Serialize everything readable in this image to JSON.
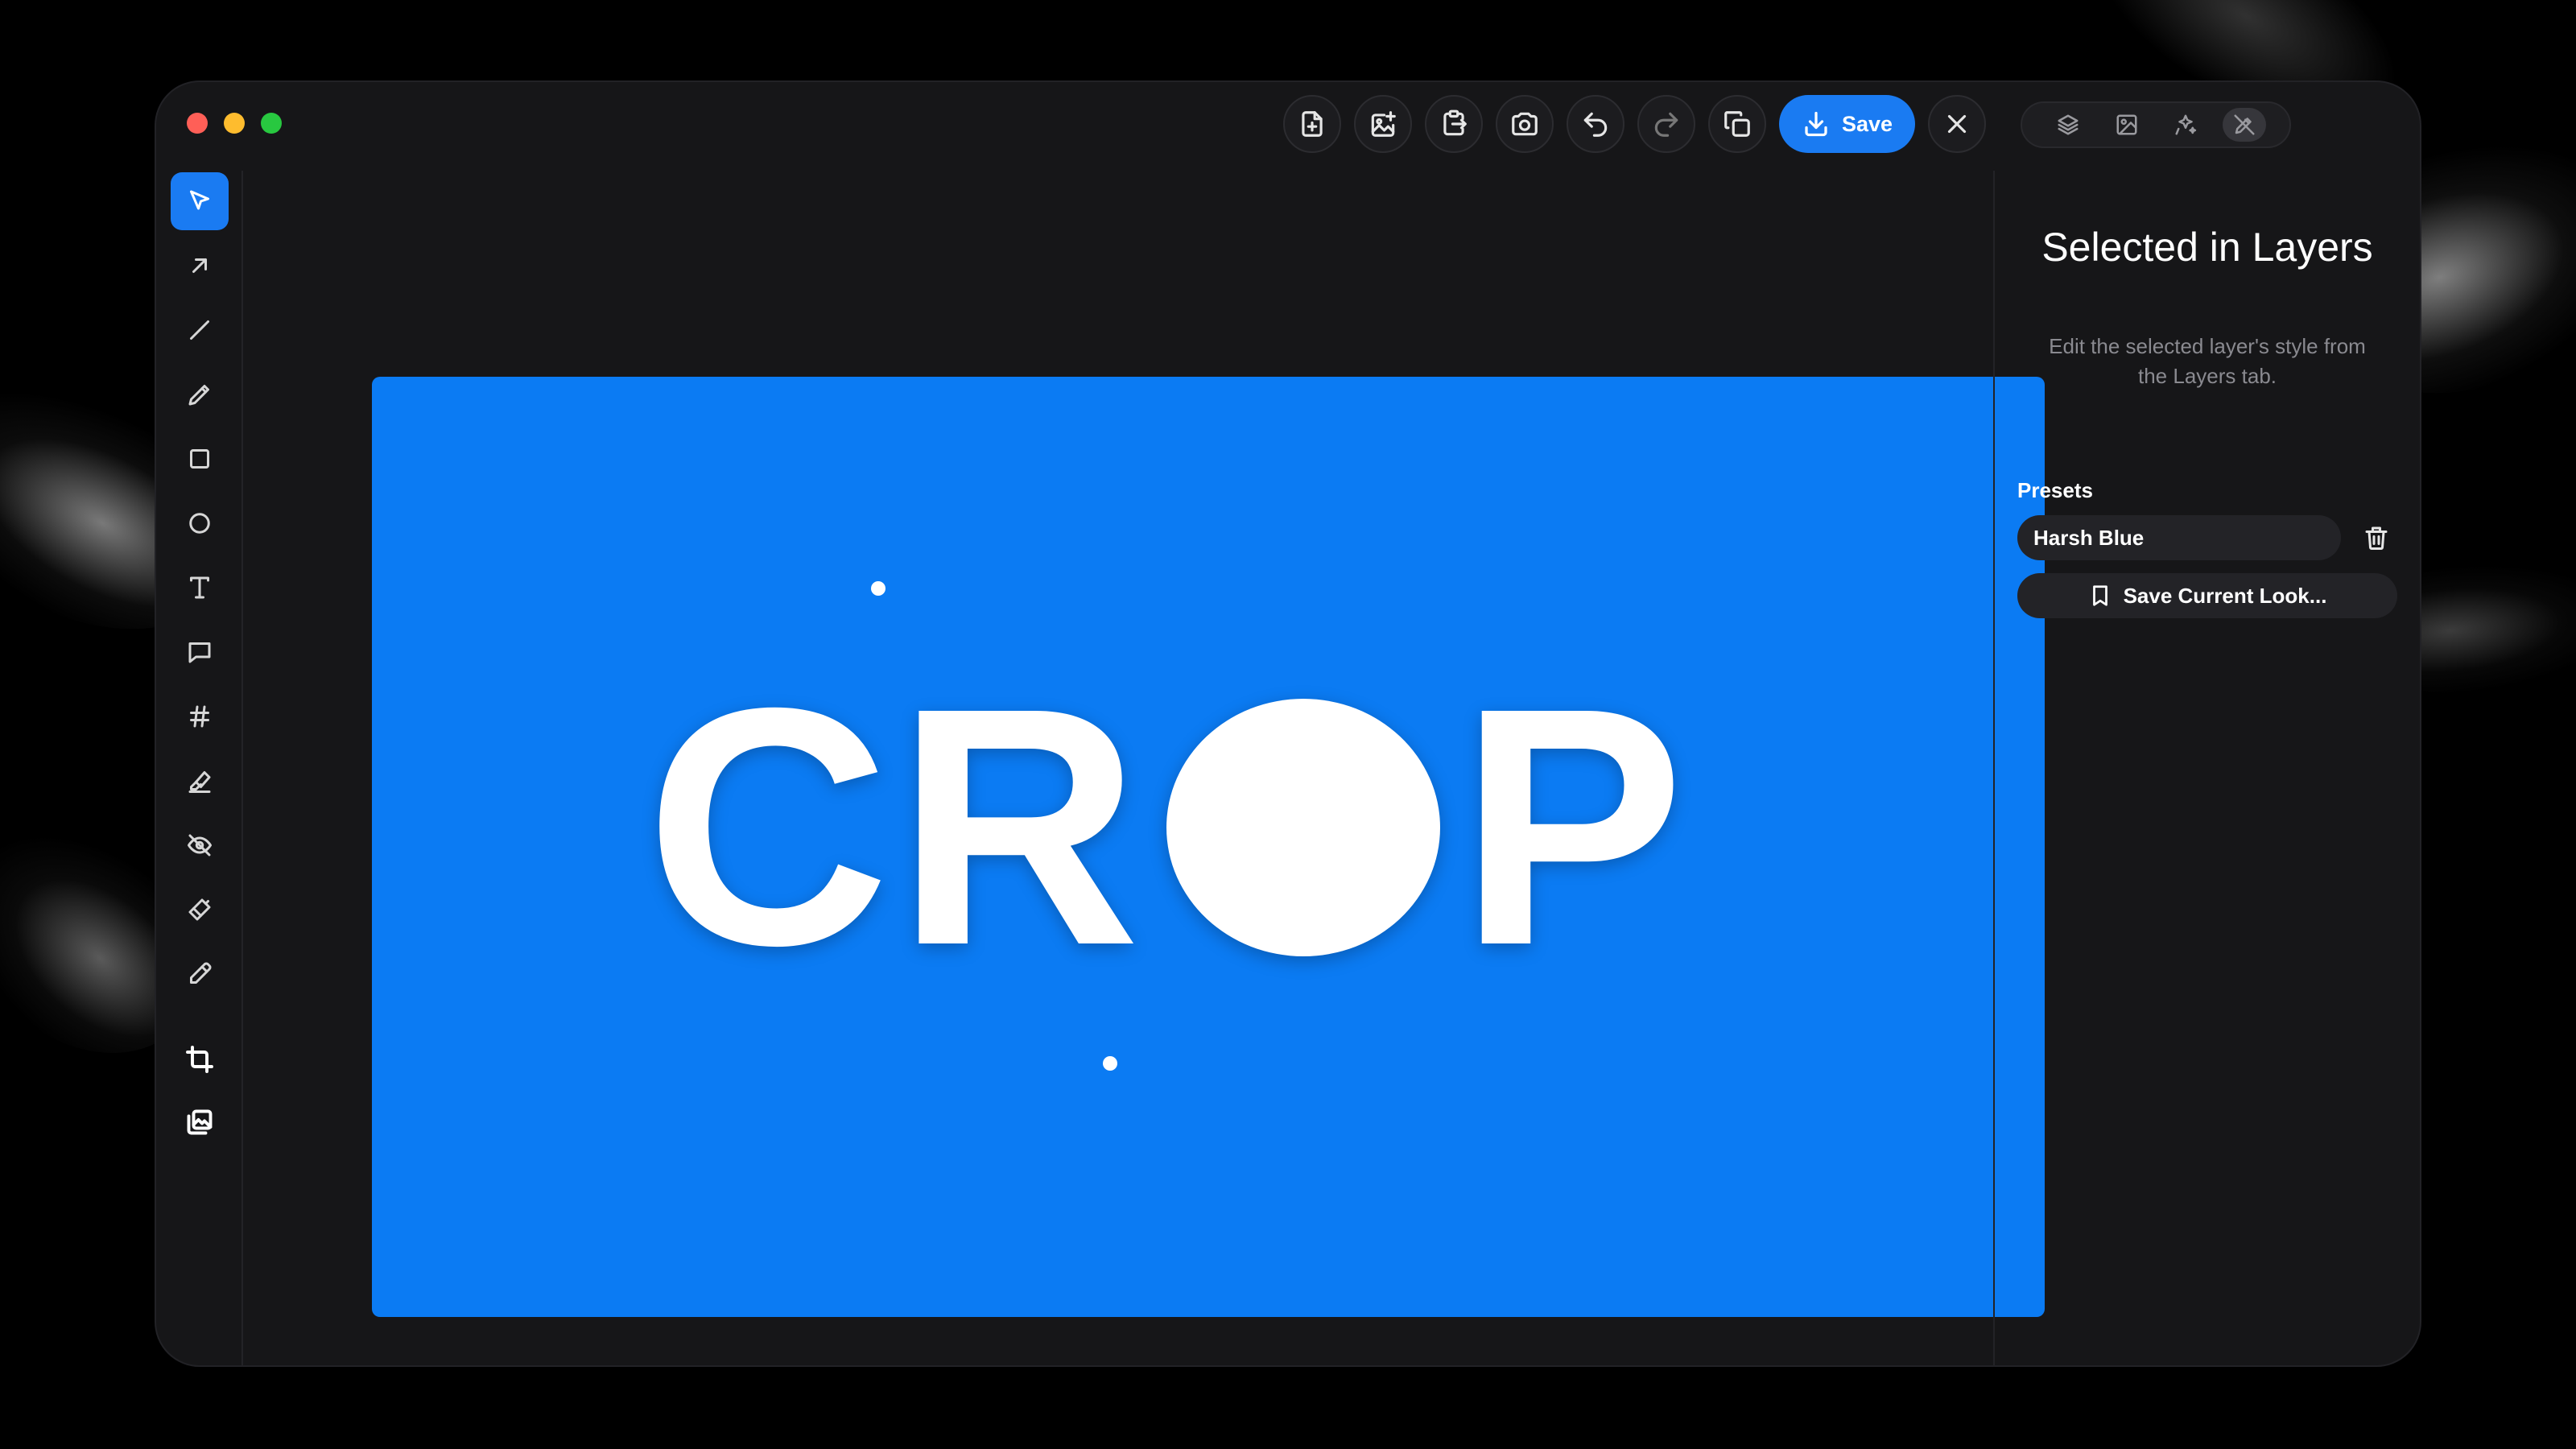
{
  "toolbar_top": {
    "save_label": "Save"
  },
  "canvas": {
    "text_left": "CR",
    "text_right": "P",
    "background_color": "#0b7bf3"
  },
  "side_panel": {
    "title": "Selected in Layers",
    "subtitle": "Edit the selected layer's style from the Layers tab.",
    "presets_label": "Presets",
    "presets": [
      {
        "name": "Harsh Blue"
      }
    ],
    "save_look_label": "Save Current Look..."
  },
  "icons": {
    "top": [
      "new-file-icon",
      "add-image-icon",
      "export-icon",
      "camera-icon",
      "undo-icon",
      "redo-icon",
      "copy-icon",
      "download-icon",
      "close-icon"
    ],
    "tabs": [
      "layers-icon",
      "image-icon",
      "effects-icon",
      "style-icon"
    ],
    "tools": [
      "select-icon",
      "arrow-icon",
      "line-icon",
      "pencil-icon",
      "rectangle-icon",
      "ellipse-icon",
      "text-icon",
      "comment-icon",
      "hash-icon",
      "highlighter-icon",
      "hide-icon",
      "brush-icon",
      "eyedropper-icon",
      "crop-icon",
      "image-overlay-icon"
    ]
  },
  "colors": {
    "accent": "#1a7bf2",
    "window_bg": "#161618"
  }
}
